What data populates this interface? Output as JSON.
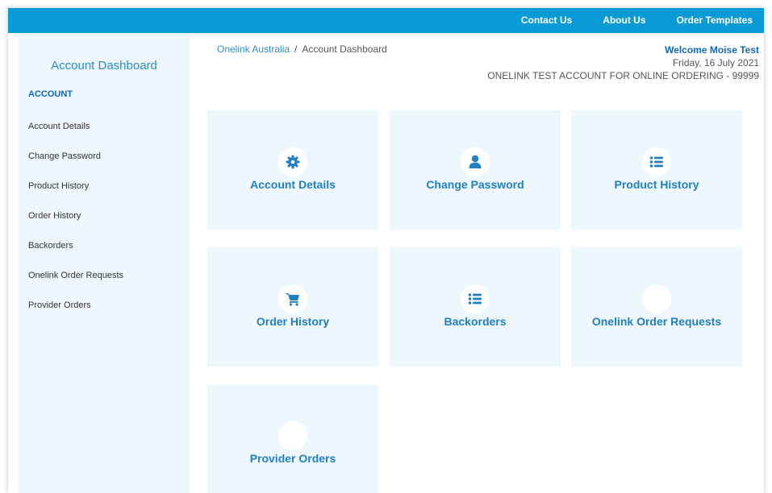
{
  "header": {
    "nav": [
      "Contact Us",
      "About Us",
      "Order Templates"
    ]
  },
  "sidebar": {
    "title": "Account Dashboard",
    "section": "ACCOUNT",
    "items": [
      {
        "label": "Account Details"
      },
      {
        "label": "Change Password"
      },
      {
        "label": "Product History"
      },
      {
        "label": "Order History"
      },
      {
        "label": "Backorders"
      },
      {
        "label": "Onelink Order Requests"
      },
      {
        "label": "Provider Orders"
      }
    ]
  },
  "breadcrumb": {
    "root": "Onelink Australia",
    "separator": "/",
    "current": "Account Dashboard"
  },
  "welcome": {
    "greeting": "Welcome Moise Test",
    "date": "Friday, 16 July 2021",
    "account": "ONELINK TEST ACCOUNT FOR ONLINE ORDERING - 99999"
  },
  "tiles": [
    {
      "label": "Account Details",
      "icon": "gear-icon"
    },
    {
      "label": "Change Password",
      "icon": "user-icon"
    },
    {
      "label": "Product History",
      "icon": "list-icon"
    },
    {
      "label": "Order History",
      "icon": "cart-icon"
    },
    {
      "label": "Backorders",
      "icon": "list-icon"
    },
    {
      "label": "Onelink Order Requests",
      "icon": "blank-icon"
    },
    {
      "label": "Provider Orders",
      "icon": "blank-icon"
    }
  ],
  "colors": {
    "topbar": "#0a9ad6",
    "accent": "#1f7fc2",
    "tile_bg": "#eef7fb"
  }
}
